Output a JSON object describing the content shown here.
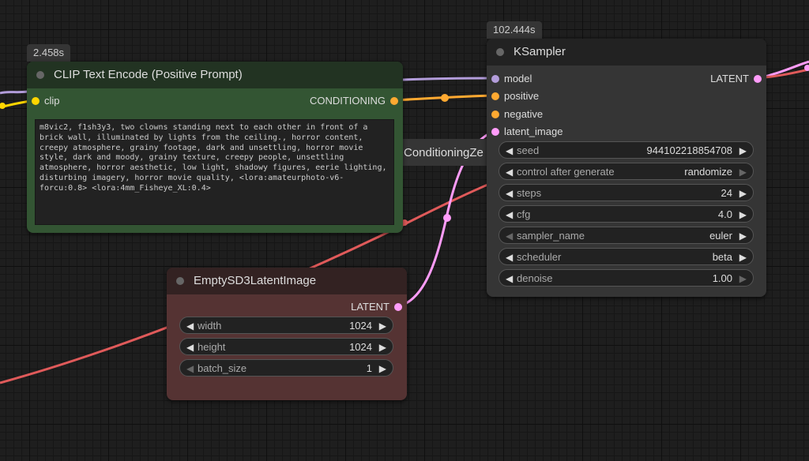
{
  "colors": {
    "canvas": "#1e1e1e",
    "link_model": "#b39ddb",
    "link_conditioning": "#ffa931",
    "link_latent": "#ff9cf9",
    "link_red": "#e05a5a",
    "clip_node_body": "#335533",
    "clip_node_title": "#223322",
    "latent_node_body": "#553333",
    "latent_node_title": "#332222",
    "ksampler_body": "#353535",
    "ksampler_title": "#222222"
  },
  "clip_node": {
    "timing": "2.458s",
    "title": "CLIP Text Encode (Positive Prompt)",
    "input_clip": "clip",
    "output_conditioning": "CONDITIONING",
    "prompt_text": "m8vic2, f1sh3y3, two clowns standing next to each other in front of a brick wall, illuminated by lights from the ceiling., horror content, creepy atmosphere, grainy footage, dark and unsettling, horror movie style, dark and moody, grainy texture, creepy people, unsettling atmosphere, horror aesthetic, low light, shadowy figures, eerie lighting, disturbing imagery, horror movie quality, <lora:amateurphoto-v6-forcu:0.8> <lora:4mm_Fisheye_XL:0.4>"
  },
  "hidden_node": {
    "title_partial": "ConditioningZe"
  },
  "ksampler": {
    "timing": "102.444s",
    "title": "KSampler",
    "inputs": [
      "model",
      "positive",
      "negative",
      "latent_image"
    ],
    "output_latent": "LATENT",
    "widgets": [
      {
        "label": "seed",
        "value": "944102218854708"
      },
      {
        "label": "control after generate",
        "value": "randomize"
      },
      {
        "label": "steps",
        "value": "24"
      },
      {
        "label": "cfg",
        "value": "4.0"
      },
      {
        "label": "sampler_name",
        "value": "euler"
      },
      {
        "label": "scheduler",
        "value": "beta"
      },
      {
        "label": "denoise",
        "value": "1.00"
      }
    ]
  },
  "latent_node": {
    "title": "EmptySD3LatentImage",
    "output_latent": "LATENT",
    "widgets": [
      {
        "label": "width",
        "value": "1024"
      },
      {
        "label": "height",
        "value": "1024"
      },
      {
        "label": "batch_size",
        "value": "1"
      }
    ]
  },
  "icons": {
    "left_arrow": "◀",
    "right_arrow": "▶"
  }
}
